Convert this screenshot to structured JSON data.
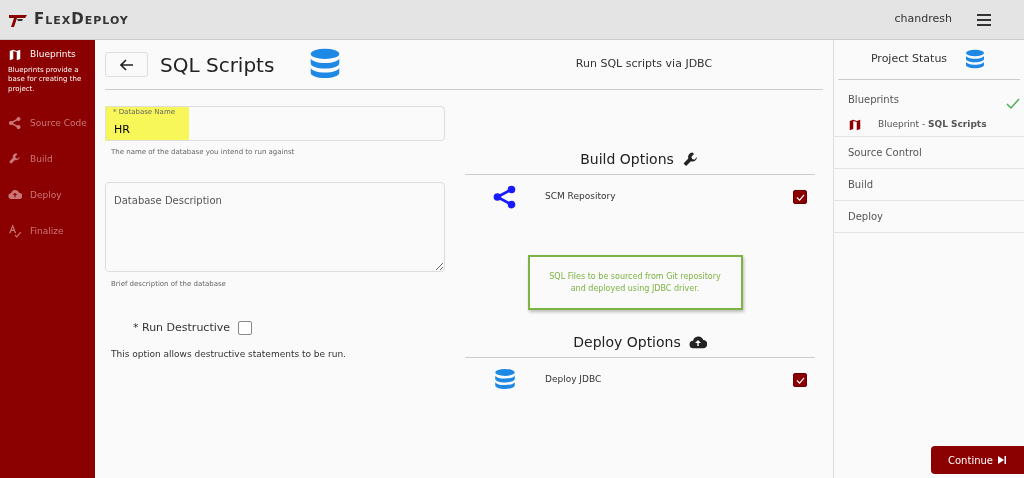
{
  "header": {
    "logo": "FlexDeploy",
    "user": "chandresh"
  },
  "sidebar": {
    "items": [
      {
        "label": "Blueprints",
        "kind": "map",
        "selected": true,
        "description": "Blueprints provide a base for creating the project."
      },
      {
        "label": "Source Code",
        "kind": "share",
        "selected": false
      },
      {
        "label": "Build",
        "kind": "wrench",
        "selected": false
      },
      {
        "label": "Deploy",
        "kind": "cloud",
        "selected": false
      },
      {
        "label": "Finalize",
        "kind": "finalize",
        "selected": false
      }
    ]
  },
  "page": {
    "title": "SQL Scripts",
    "subtitle": "Run SQL scripts via JDBC"
  },
  "form": {
    "database_name": {
      "label": "* Database Name",
      "value": "HR",
      "highlighted": true,
      "help": "The name of the database you intend to run against"
    },
    "database_description": {
      "placeholder": "Database Description",
      "help": "Brief description of the database"
    },
    "run_destructive": {
      "label": "* Run Destructive",
      "checked": false,
      "help": "This option allows destructive statements to be run."
    }
  },
  "build_options": {
    "title": "Build Options",
    "items": [
      {
        "label": "SCM Repository",
        "kind": "share",
        "checked": true
      }
    ]
  },
  "note": "SQL Files to be sourced from Git repository and deployed using JDBC driver.",
  "deploy_options": {
    "title": "Deploy Options",
    "items": [
      {
        "label": "Deploy JDBC",
        "kind": "database",
        "checked": true
      }
    ]
  },
  "project_status": {
    "title": "Project Status",
    "steps": [
      {
        "label": "Blueprints",
        "done": true,
        "detail": "Blueprint - **SQL Scripts**"
      },
      {
        "label": "Source Control",
        "done": false
      },
      {
        "label": "Build",
        "done": false
      },
      {
        "label": "Deploy",
        "done": false
      }
    ]
  },
  "continue_button": "Continue"
}
